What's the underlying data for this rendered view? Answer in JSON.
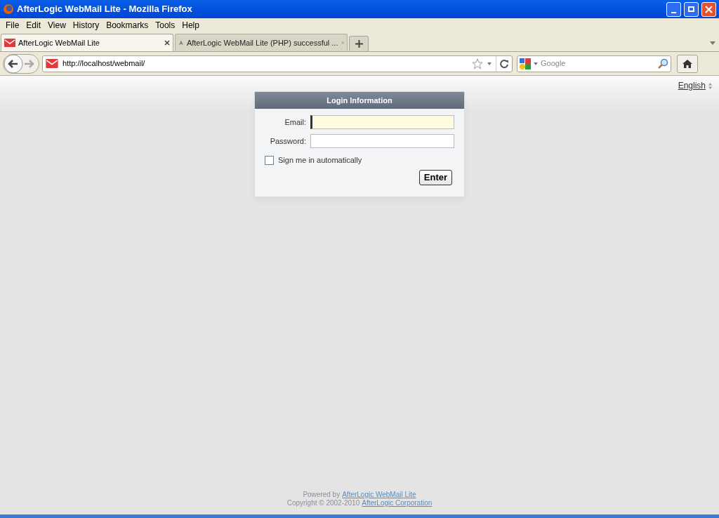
{
  "window": {
    "title": "AfterLogic WebMail Lite - Mozilla Firefox"
  },
  "menu": [
    "File",
    "Edit",
    "View",
    "History",
    "Bookmarks",
    "Tools",
    "Help"
  ],
  "tabs": [
    {
      "label": "AfterLogic WebMail Lite",
      "selected": true
    },
    {
      "label": "AfterLogic WebMail Lite (PHP) successful ...",
      "selected": false
    }
  ],
  "address_bar": {
    "url": "http://localhost/webmail/"
  },
  "search": {
    "placeholder": "Google"
  },
  "language": "English",
  "login": {
    "title": "Login Information",
    "fields": [
      {
        "label": "Email:",
        "focused": true
      },
      {
        "label": "Password:",
        "focused": false
      }
    ],
    "remember": {
      "label": "Sign me in automatically",
      "checked": false
    },
    "button": "Enter"
  },
  "footer": [
    {
      "text": "Powered by",
      "link": "AfterLogic WebMail Lite"
    },
    {
      "text": "Copyright © 2002-2010",
      "link": "AfterLogic Corporation"
    }
  ]
}
